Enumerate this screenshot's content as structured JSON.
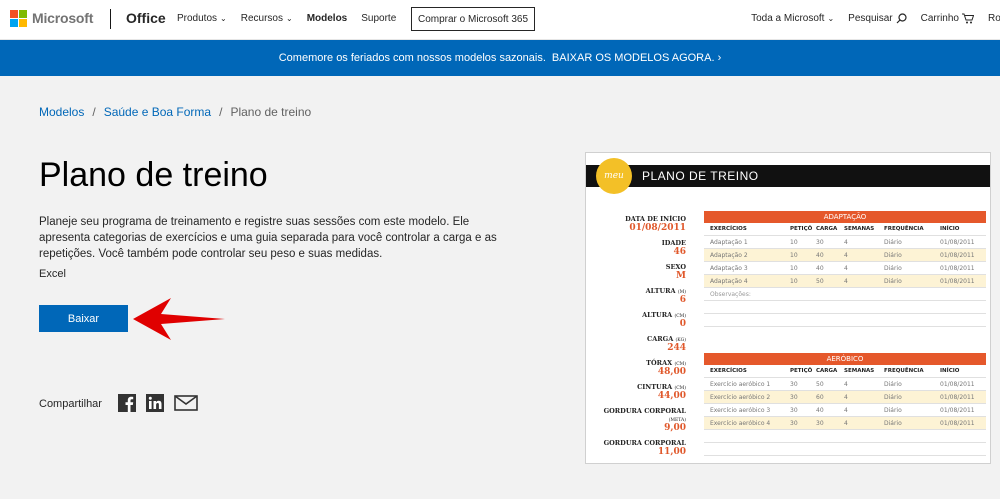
{
  "header": {
    "brand": "Microsoft",
    "product": "Office",
    "nav": [
      "Produtos",
      "Recursos",
      "Modelos",
      "Suporte"
    ],
    "buy_button": "Comprar o Microsoft 365",
    "all_microsoft": "Toda a Microsoft",
    "search": "Pesquisar",
    "cart": "Carrinho",
    "profile_partial": "Ro",
    "logo_colors": [
      "#f25022",
      "#7fba00",
      "#00a4ef",
      "#ffb900"
    ]
  },
  "banner": {
    "text": "Comemore os feriados com nossos modelos sazonais.",
    "link": "BAIXAR OS MODELOS AGORA."
  },
  "breadcrumb": [
    "Modelos",
    "Saúde e Boa Forma",
    "Plano de treino"
  ],
  "main": {
    "title": "Plano de treino",
    "description": "Planeje seu programa de treinamento e registre suas sessões com este modelo. Ele apresenta categorias de exercícios e uma guia separada para você controlar a carga e as repetições. Você também pode controlar seu peso e suas medidas.",
    "app": "Excel",
    "download_label": "Baixar",
    "share_label": "Compartilhar",
    "share_icons": [
      "facebook-icon",
      "linkedin-icon",
      "email-icon"
    ]
  },
  "preview": {
    "badge": "meu",
    "title": "PLANO DE TREINO",
    "left": [
      {
        "label": "DATA DE INÍCIO",
        "unit": "",
        "value": "01/08/2011"
      },
      {
        "label": "IDADE",
        "unit": "",
        "value": "46"
      },
      {
        "label": "SEXO",
        "unit": "",
        "value": "M"
      },
      {
        "label": "ALTURA",
        "unit": "(M)",
        "value": "6"
      },
      {
        "label": "ALTURA",
        "unit": "(CM)",
        "value": "0"
      },
      {
        "label": "CARGA",
        "unit": "(KG)",
        "value": "244"
      },
      {
        "label": "TÓRAX",
        "unit": "(CM)",
        "value": "48,00"
      },
      {
        "label": "CINTURA",
        "unit": "(CM)",
        "value": "44,00"
      },
      {
        "label": "GORDURA CORPORAL",
        "unit": "(META)",
        "value": "9,00"
      },
      {
        "label": "GORDURA CORPORAL",
        "unit": "",
        "value": "11,00"
      }
    ],
    "columns": [
      "EXERCÍCIOS",
      "PETIÇÕ",
      "CARGA",
      "SEMANAS",
      "FREQUÊNCIA",
      "INÍCIO"
    ],
    "tables": [
      {
        "header": "ADAPTAÇÃO",
        "rows": [
          [
            "Adaptação 1",
            "10",
            "30",
            "4",
            "Diário",
            "01/08/2011"
          ],
          [
            "Adaptação 2",
            "10",
            "40",
            "4",
            "Diário",
            "01/08/2011"
          ],
          [
            "Adaptação 3",
            "10",
            "40",
            "4",
            "Diário",
            "01/08/2011"
          ],
          [
            "Adaptação 4",
            "10",
            "50",
            "4",
            "Diário",
            "01/08/2011"
          ]
        ],
        "notes": "Observações:"
      },
      {
        "header": "AERÓBICO",
        "rows": [
          [
            "Exercício aeróbico 1",
            "30",
            "50",
            "4",
            "Diário",
            "01/08/2011"
          ],
          [
            "Exercício aeróbico 2",
            "30",
            "60",
            "4",
            "Diário",
            "01/08/2011"
          ],
          [
            "Exercício aeróbico 3",
            "30",
            "40",
            "4",
            "Diário",
            "01/08/2011"
          ],
          [
            "Exercício aeróbico 4",
            "30",
            "30",
            "4",
            "Diário",
            "01/08/2011"
          ]
        ]
      }
    ]
  },
  "colors": {
    "accent": "#0067b8",
    "preview_orange": "#e5582b",
    "arrow_red": "#e00000"
  }
}
